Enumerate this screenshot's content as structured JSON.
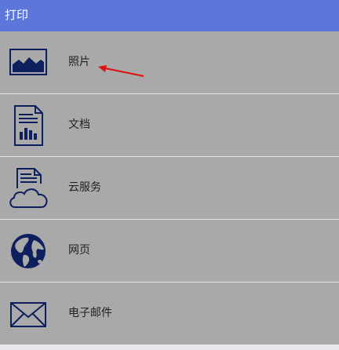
{
  "window": {
    "title": "打印"
  },
  "items": [
    {
      "label": "照片",
      "icon": "photo-icon"
    },
    {
      "label": "文档",
      "icon": "document-icon"
    },
    {
      "label": "云服务",
      "icon": "cloud-icon"
    },
    {
      "label": "网页",
      "icon": "globe-icon"
    },
    {
      "label": "电子邮件",
      "icon": "envelope-icon"
    }
  ],
  "colors": {
    "titlebar": "#5c76d9",
    "background": "#a9a9a9",
    "icon": "#0d1f5c",
    "arrow": "#e01010"
  },
  "annotation": {
    "arrow": "red-arrow-pointing-to-photo"
  }
}
